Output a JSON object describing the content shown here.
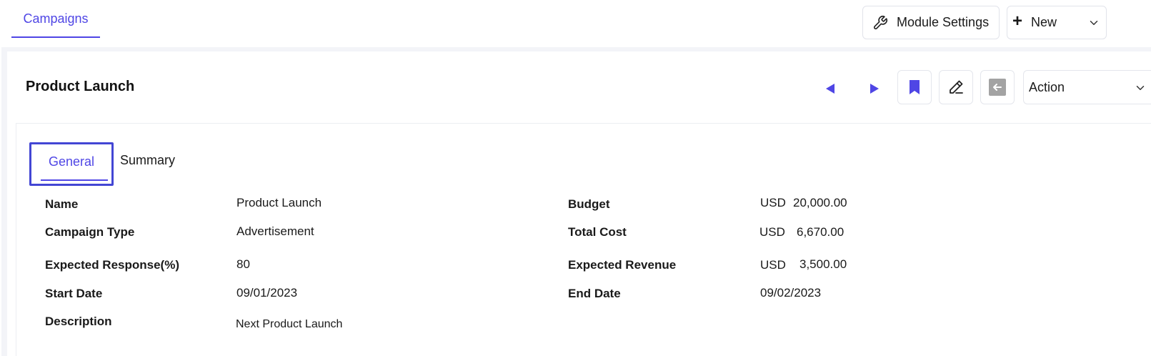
{
  "header": {
    "tab_label": "Campaigns",
    "module_settings_label": "Module Settings",
    "new_label": "New"
  },
  "record": {
    "title": "Product Launch",
    "action_label": "Action"
  },
  "tabs": {
    "general": "General",
    "summary": "Summary"
  },
  "fields": {
    "name": {
      "label": "Name",
      "value": "Product Launch"
    },
    "campaign_type": {
      "label": "Campaign Type",
      "value": "Advertisement"
    },
    "expected_response": {
      "label": "Expected Response(%)",
      "value": "80"
    },
    "start_date": {
      "label": "Start Date",
      "value": "09/01/2023"
    },
    "description": {
      "label": "Description",
      "value": "Next Product Launch"
    },
    "budget": {
      "label": "Budget",
      "currency": "USD",
      "amount": "20,000.00"
    },
    "total_cost": {
      "label": "Total Cost",
      "currency": "USD",
      "amount": "6,670.00"
    },
    "expected_revenue": {
      "label": "Expected Revenue",
      "currency": "USD",
      "amount": "3,500.00"
    },
    "end_date": {
      "label": "End Date",
      "value": "09/02/2023"
    }
  },
  "colors": {
    "accent": "#4f46e5",
    "back_icon_bg": "#a3a3a3"
  },
  "icons": {
    "settings": "wrench-icon",
    "new": "plus-icon",
    "prev": "triangle-left-icon",
    "next": "triangle-right-icon",
    "bookmark": "bookmark-icon",
    "edit": "pencil-icon",
    "back": "arrow-left-icon",
    "dropdown": "chevron-down-icon"
  }
}
